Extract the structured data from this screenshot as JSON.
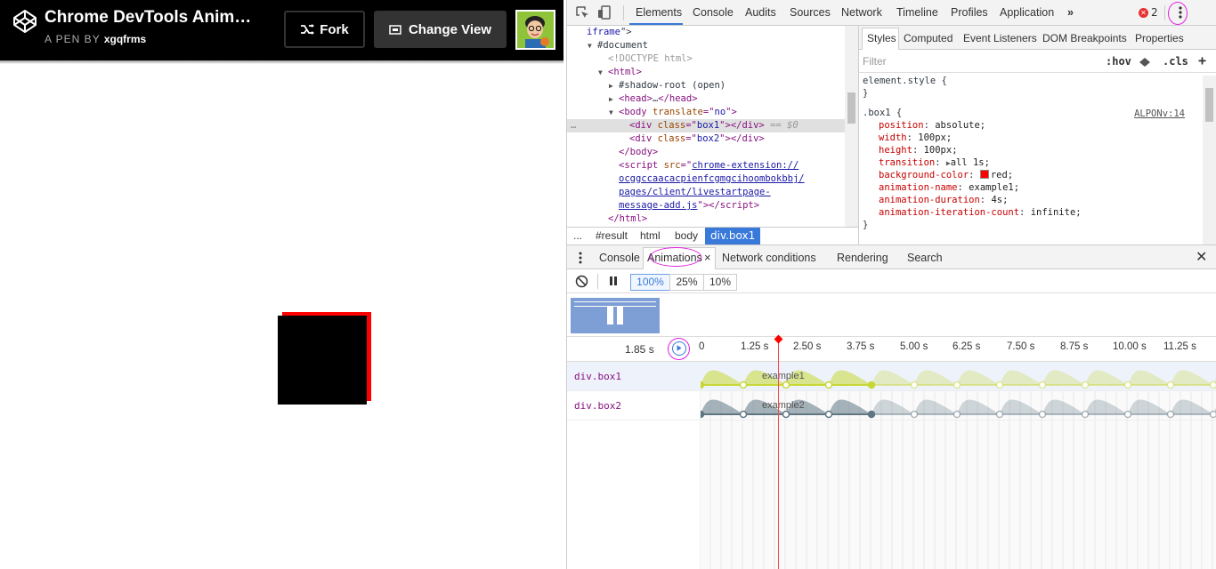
{
  "pen": {
    "title": "Chrome DevTools Anim…",
    "byline_prefix": "A PEN BY",
    "author": "xgqfrms",
    "fork_label": "Fork",
    "change_view_label": "Change View"
  },
  "devtools": {
    "tabs": [
      "Elements",
      "Console",
      "Audits",
      "Sources",
      "Network",
      "Timeline",
      "Profiles",
      "Application"
    ],
    "more_tabs": "»",
    "error_count": "2",
    "elements": {
      "lines": [
        {
          "indent": 2,
          "arrow": "",
          "html": "<span class=\"val\">iframe</span>\">"
        },
        {
          "indent": 3,
          "arrow": "▼",
          "html": "#document"
        },
        {
          "indent": 4,
          "arrow": "",
          "html": "<span class=\"cm\">&lt;!DOCTYPE html&gt;</span>"
        },
        {
          "indent": 4,
          "arrow": "▼",
          "html": "<span class=\"tag\">&lt;html&gt;</span>"
        },
        {
          "indent": 5,
          "arrow": "▶",
          "html": "#shadow-root (open)"
        },
        {
          "indent": 5,
          "arrow": "▶",
          "html": "<span class=\"tag\">&lt;head&gt;</span>…<span class=\"tag\">&lt;/head&gt;</span>"
        },
        {
          "indent": 5,
          "arrow": "▼",
          "html": "<span class=\"tag\">&lt;body </span><span class=\"attr\">translate</span><span class=\"tag\">=\"</span><span class=\"val\">no</span><span class=\"tag\">\"&gt;</span>"
        },
        {
          "indent": 6,
          "arrow": "",
          "sel": true,
          "html": "<span class=\"tag\">&lt;div </span><span class=\"attr\">class</span><span class=\"tag\">=\"</span><span class=\"val\">box1</span><span class=\"tag\">\"&gt;&lt;/div&gt;</span> <span class=\"cm\">== <i>$0</i></span>"
        },
        {
          "indent": 6,
          "arrow": "",
          "html": "<span class=\"tag\">&lt;div </span><span class=\"attr\">class</span><span class=\"tag\">=\"</span><span class=\"val\">box2</span><span class=\"tag\">\"&gt;&lt;/div&gt;</span>"
        },
        {
          "indent": 5,
          "arrow": "",
          "html": "<span class=\"tag\">&lt;/body&gt;</span>"
        },
        {
          "indent": 5,
          "arrow": "",
          "html": "<span class=\"tag\">&lt;script </span><span class=\"attr\">src</span><span class=\"tag\">=\"</span><span class=\"lnk\">chrome-extension://</span>"
        },
        {
          "indent": 5,
          "arrow": "",
          "html": "<span class=\"lnk\">ocggccaacacpienfcgmgcihoombokbbj/</span>"
        },
        {
          "indent": 5,
          "arrow": "",
          "html": "<span class=\"lnk\">pages/client/livestartpage-</span>"
        },
        {
          "indent": 5,
          "arrow": "",
          "html": "<span class=\"lnk\">message-add.js</span><span class=\"tag\">\"&gt;&lt;/script&gt;</span>"
        },
        {
          "indent": 4,
          "arrow": "",
          "html": "<span class=\"tag\">&lt;/html&gt;</span>"
        }
      ],
      "breadcrumbs": [
        "...",
        "#result",
        "html",
        "body"
      ],
      "breadcrumb_active": "div.box1"
    },
    "styles": {
      "tabs": [
        "Styles",
        "Computed",
        "Event Listeners",
        "DOM Breakpoints",
        "Properties"
      ],
      "filter_placeholder": "Filter",
      "hov": ":hov",
      "cls": ".cls",
      "element_style": "element.style {",
      "close_brace": "}",
      "selector": ".box1 {",
      "source": "ALPONv:14",
      "props": [
        {
          "name": "position",
          "value": "absolute;"
        },
        {
          "name": "width",
          "value": "100px;"
        },
        {
          "name": "height",
          "value": "100px;"
        },
        {
          "name": "transition",
          "value": "all 1s;",
          "triangle": true
        },
        {
          "name": "background-color",
          "value": "red;",
          "swatch": "#ff0000"
        },
        {
          "name": "animation-name",
          "value": "example1;"
        },
        {
          "name": "animation-duration",
          "value": "4s;"
        },
        {
          "name": "animation-iteration-count",
          "value": "infinite;"
        }
      ]
    },
    "drawer": {
      "tabs": [
        "Console",
        "Animations",
        "Network conditions",
        "Rendering",
        "Search"
      ],
      "speeds": [
        "100%",
        "25%",
        "10%"
      ],
      "time_readout": "1.85 s",
      "ticks": [
        "0",
        "1.25 s",
        "2.50 s",
        "3.75 s",
        "5.00 s",
        "6.25 s",
        "7.50 s",
        "8.75 s",
        "10.00 s",
        "11.25 s"
      ],
      "tracks": [
        {
          "name": "div.box1",
          "animation": "example1",
          "color": "#c7d835"
        },
        {
          "name": "div.box2",
          "animation": "example2",
          "color": "#5f7683"
        }
      ]
    }
  },
  "colors": {
    "accent": "#3879d9",
    "annotation": "#e020e0",
    "playhead": "#ff0000"
  }
}
